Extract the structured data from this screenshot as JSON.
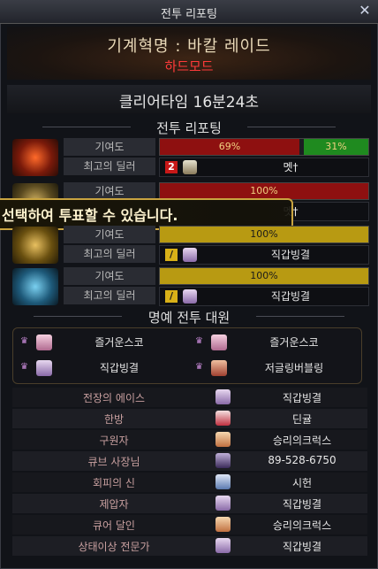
{
  "window": {
    "title": "전투 리포팅",
    "close": "✕"
  },
  "header": {
    "mode": "기계혁명 : 바칼 레이드",
    "difficulty": "하드모드"
  },
  "clear_time": "클리어타임  16분24초",
  "sections": {
    "report": "전투 리포팅",
    "honor": "명예 전투 대원"
  },
  "labels": {
    "contribution": "기여도",
    "best_dealer": "최고의 딜러"
  },
  "parties": [
    {
      "emblem": "fire-emblem",
      "contrib_a": "69%",
      "contrib_b": "31%",
      "contrib_a_value": 69,
      "contrib_b_value": 31,
      "dealer_badge": "2",
      "dealer": "멧†"
    },
    {
      "emblem": "earth-emblem",
      "contrib_a": "100%",
      "contrib_a_value": 100,
      "dealer": "멧†"
    },
    {
      "emblem": "gold-emblem",
      "contrib_a": "100%",
      "contrib_a_value": 100,
      "dealer_badge": "/",
      "dealer": "직갑빙결"
    },
    {
      "emblem": "ice-emblem",
      "contrib_a": "100%",
      "contrib_a_value": 100,
      "dealer_badge": "/",
      "dealer": "직갑빙결"
    }
  ],
  "overlay_notice": "선택하여 투표할 수 있습니다.",
  "honor": [
    "즐거운스코",
    "즐거운스코",
    "직갑빙결",
    "저글링버블링"
  ],
  "awards": [
    {
      "title": "전장의 에이스",
      "player": "직갑빙결"
    },
    {
      "title": "한방",
      "player": "딘귤"
    },
    {
      "title": "구원자",
      "player": "승리의크럭스"
    },
    {
      "title": "큐브 사장님",
      "player": "89-528-6750"
    },
    {
      "title": "회피의 신",
      "player": "시헌"
    },
    {
      "title": "제압자",
      "player": "직갑빙결"
    },
    {
      "title": "큐어 달인",
      "player": "승리의크럭스"
    },
    {
      "title": "상태이상 전문가",
      "player": "직갑빙결"
    }
  ],
  "colors": {
    "bar_red": "#8e1010",
    "bar_green": "#1f8a1f",
    "bar_gold": "#b89a12",
    "accent": "#c9a440"
  }
}
